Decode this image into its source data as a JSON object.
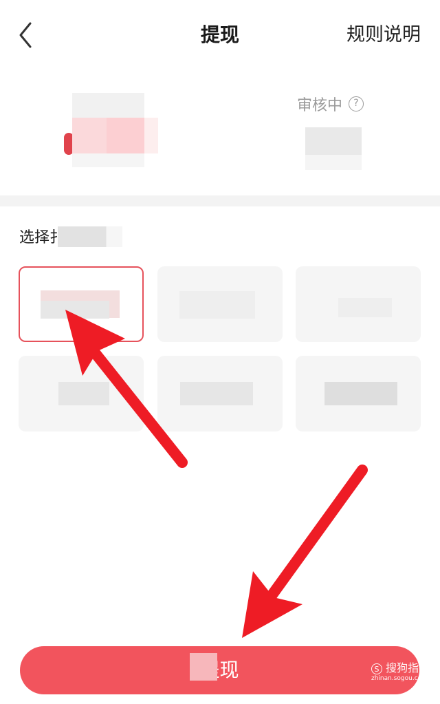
{
  "header": {
    "title": "提现",
    "rules_link": "规则说明"
  },
  "summary": {
    "review_label": "审核中",
    "help_symbol": "?"
  },
  "choose": {
    "label": "选择扌"
  },
  "options_count": 6,
  "primary_button": {
    "label": "提现"
  },
  "watermark": {
    "brand": "搜狗指南",
    "site": "zhinan.sogou.com",
    "logo_glyph": "S"
  },
  "colors": {
    "accent_red": "#f2545d",
    "selected_border": "#e6525b",
    "annotation_arrow": "#ee1c25"
  }
}
